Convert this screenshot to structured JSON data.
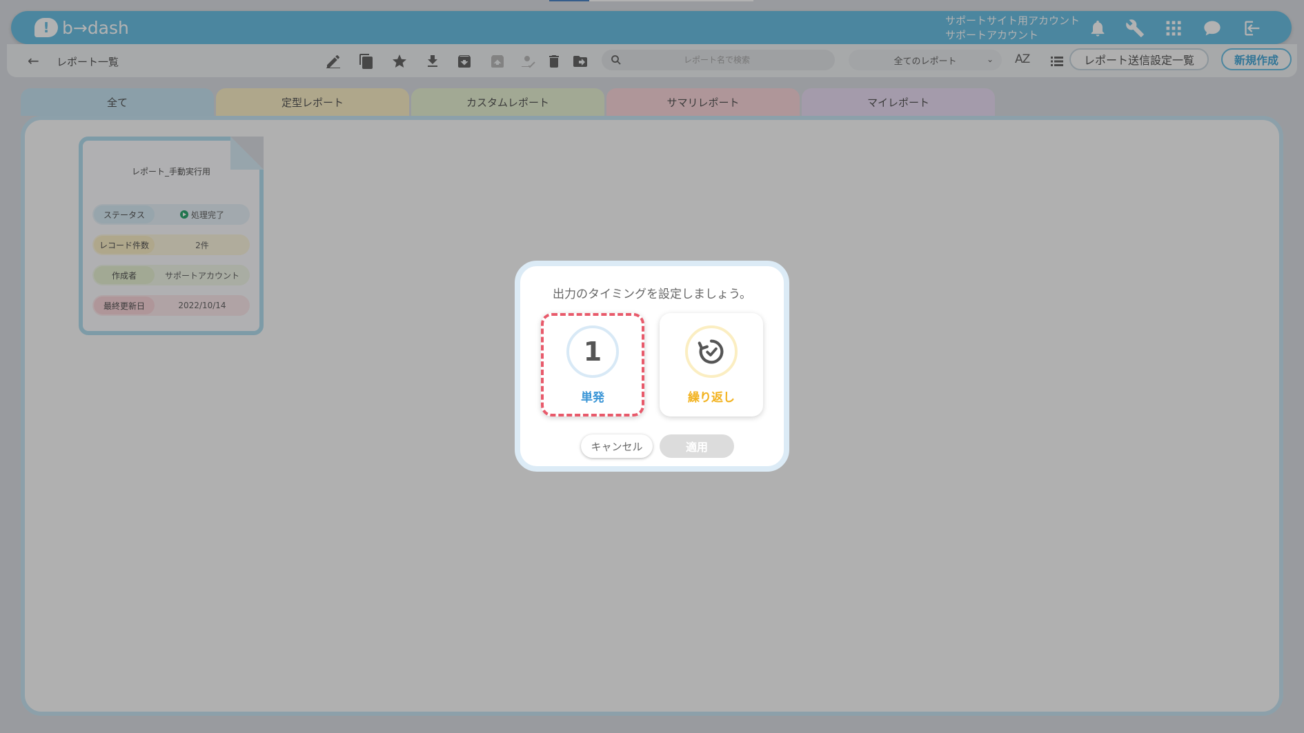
{
  "header": {
    "logo_text": "b→dash",
    "account_line1": "サポートサイト用アカウント",
    "account_line2": "サポートアカウント",
    "icons": [
      "bell-icon",
      "wrench-icon",
      "apps-grid-icon",
      "chat-bubble-icon",
      "logout-icon"
    ],
    "accent_color": "#6cc0e4"
  },
  "toolbar": {
    "breadcrumb": "レポート一覧",
    "back_icon": "back-arrow-icon",
    "icons": [
      "edit-icon",
      "copy-icon",
      "star-icon",
      "download-icon",
      "archive-icon",
      "archive-disabled-icon",
      "assign-user-icon",
      "trash-icon",
      "move-folder-icon"
    ],
    "search_placeholder": "レポート名で検索",
    "filter_value": "全てのレポート",
    "sort_label": "AZ",
    "send_settings_label": "レポート送信設定一覧",
    "new_label": "新規作成"
  },
  "tabs": [
    {
      "label": "全て",
      "color": "#c8e4f2"
    },
    {
      "label": "定型レポート",
      "color": "#fbefc8"
    },
    {
      "label": "カスタムレポート",
      "color": "#e9f3d4"
    },
    {
      "label": "サマリレポート",
      "color": "#fbd7dc"
    },
    {
      "label": "マイレポート",
      "color": "#ebdef5"
    }
  ],
  "report_card": {
    "title": "レポート_手動実行用",
    "rows": [
      {
        "key": "ステータス",
        "value": "処理完了",
        "key_color": "#d9ecf6"
      },
      {
        "key": "レコード件数",
        "value": "2件",
        "key_color": "#fbefc8"
      },
      {
        "key": "作成者",
        "value": "サポートアカウント",
        "key_color": "#e9f3d4"
      },
      {
        "key": "最終更新日",
        "value": "2022/10/14",
        "key_color": "#fbd7dc"
      }
    ]
  },
  "modal": {
    "title": "出力のタイミングを設定しましょう。",
    "option_single_number": "1",
    "option_single_label": "単発",
    "option_repeat_label": "繰り返し",
    "option_repeat_icon": "repeat-clock-icon",
    "selected": "単発",
    "cancel_label": "キャンセル",
    "apply_label": "適用",
    "single_color": "#3a95d6",
    "repeat_color": "#f2b21e",
    "selection_color": "#e85a6b"
  }
}
